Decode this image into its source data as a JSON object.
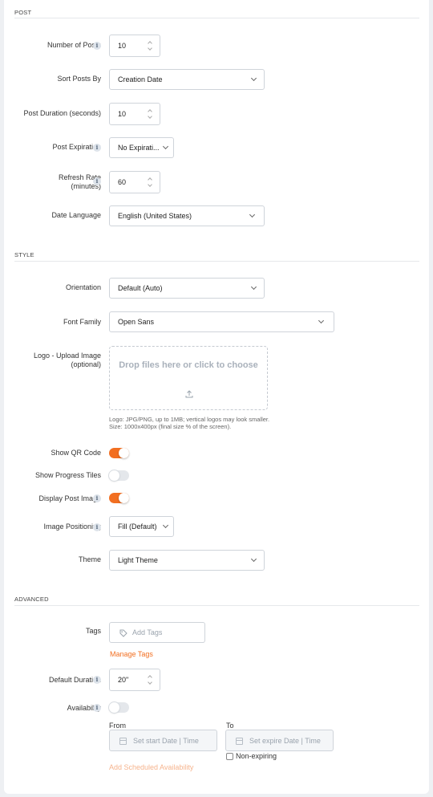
{
  "sections": {
    "post": "POST",
    "style": "STYLE",
    "advanced": "ADVANCED"
  },
  "post": {
    "number_of_posts": {
      "label": "Number of Posts",
      "value": "10"
    },
    "sort_posts_by": {
      "label": "Sort Posts By",
      "value": "Creation Date"
    },
    "post_duration": {
      "label": "Post Duration (seconds)",
      "value": "10"
    },
    "post_expiration": {
      "label": "Post Expiration",
      "value": "No Expirati..."
    },
    "refresh_rate": {
      "label_line1": "Refresh Rate",
      "label_line2": "(minutes)",
      "value": "60"
    },
    "date_language": {
      "label": "Date Language",
      "value": "English (United States)"
    }
  },
  "style": {
    "orientation": {
      "label": "Orientation",
      "value": "Default (Auto)"
    },
    "font_family": {
      "label": "Font Family",
      "value": "Open Sans"
    },
    "logo": {
      "label_line1": "Logo - Upload Image",
      "label_line2": "(optional)",
      "drop_text": "Drop files here or click to choose",
      "help_line1": "Logo: JPG/PNG, up to 1MB; vertical logos may look smaller.",
      "help_line2": "Size: 1000x400px (final size % of the screen)."
    },
    "show_qr_code": {
      "label": "Show QR Code",
      "on": true
    },
    "show_progress_tiles": {
      "label": "Show Progress Tiles",
      "on": false
    },
    "display_post_image": {
      "label": "Display Post Image",
      "on": true
    },
    "image_positioning": {
      "label": "Image Positioning",
      "value": "Fill (Default)"
    },
    "theme": {
      "label": "Theme",
      "value": "Light Theme"
    }
  },
  "advanced": {
    "tags": {
      "label": "Tags",
      "placeholder": "Add Tags",
      "manage_link": "Manage Tags"
    },
    "default_duration": {
      "label": "Default Duration",
      "value": "20\""
    },
    "availability": {
      "label": "Availability",
      "on": false,
      "from_label": "From",
      "to_label": "To",
      "from_placeholder": "Set start Date | Time",
      "to_placeholder": "Set expire Date | Time",
      "non_expiring": "Non-expiring",
      "add_link": "Add Scheduled Availability"
    }
  },
  "icons": {
    "info": "i",
    "accent_color": "#f26f21"
  }
}
